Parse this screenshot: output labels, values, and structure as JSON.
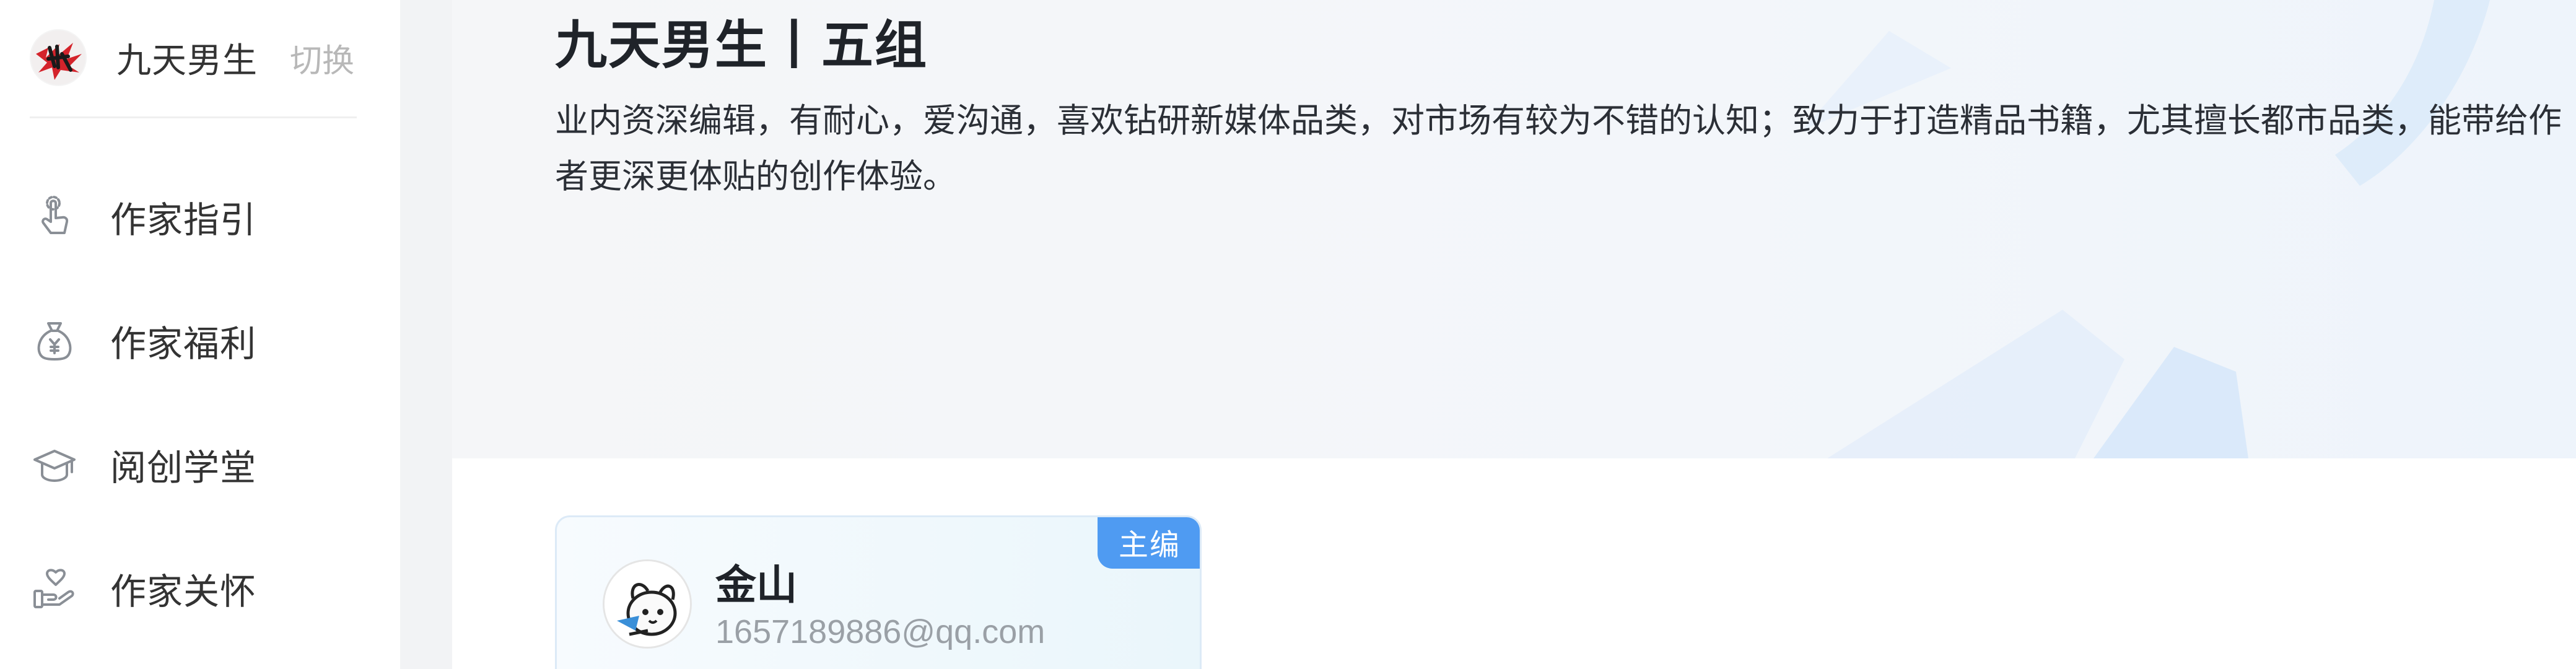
{
  "sidebar": {
    "account_name": "九天男生",
    "switch_label": "切换",
    "items": [
      {
        "label": "作家指引",
        "icon": "touch-guide-icon"
      },
      {
        "label": "作家福利",
        "icon": "money-bag-icon"
      },
      {
        "label": "阅创学堂",
        "icon": "graduation-cap-icon"
      },
      {
        "label": "作家关怀",
        "icon": "hand-heart-icon"
      }
    ]
  },
  "main": {
    "group_title": "九天男生丨五组",
    "group_description": "业内资深编辑，有耐心，爱沟通，喜欢钻研新媒体品类，对市场有较为不错的认知；致力于打造精品书籍，尤其擅长都市品类，能带给作者更深更体贴的创作体验。",
    "editor": {
      "role": "主编",
      "name": "金山",
      "email": "1657189886@qq.com"
    }
  },
  "colors": {
    "accent": "#4f9bf2",
    "sidebar_divider": "#f2f3f5",
    "logo_red": "#d4232b"
  }
}
